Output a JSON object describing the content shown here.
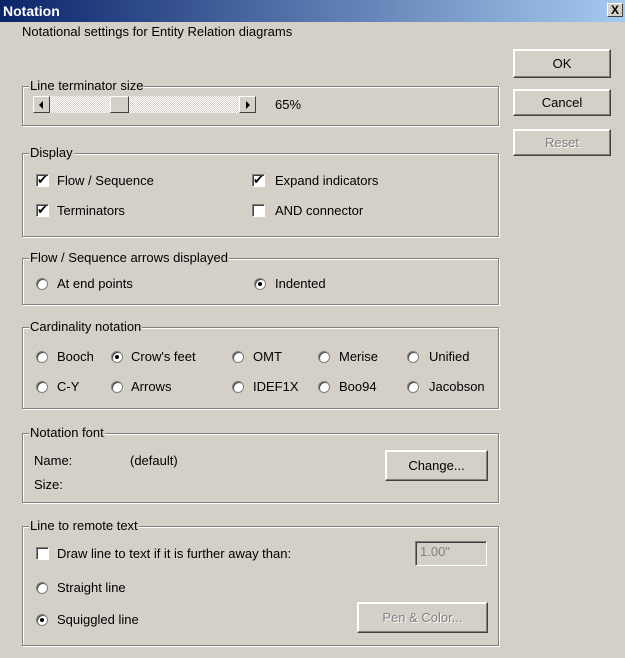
{
  "window": {
    "title": "Notation",
    "close_glyph": "X"
  },
  "intro": "Notational settings for Entity Relation diagrams",
  "buttons": {
    "ok": "OK",
    "cancel": "Cancel",
    "reset": "Reset"
  },
  "line_terminator": {
    "legend": "Line terminator size",
    "value_label": "65%",
    "value_fraction": 0.65
  },
  "display": {
    "legend": "Display",
    "flow_sequence": {
      "label": "Flow / Sequence",
      "checked": true
    },
    "expand_indicators": {
      "label": "Expand indicators",
      "checked": true
    },
    "terminators": {
      "label": "Terminators",
      "checked": true
    },
    "and_connector": {
      "label": "AND connector",
      "checked": false
    }
  },
  "arrows": {
    "legend": "Flow / Sequence arrows displayed",
    "at_end_points": "At end points",
    "indented": "Indented",
    "selected": "Indented"
  },
  "cardinality": {
    "legend": "Cardinality notation",
    "options": [
      "Booch",
      "Crow's feet",
      "OMT",
      "Merise",
      "Unified",
      "C-Y",
      "Arrows",
      "IDEF1X",
      "Boo94",
      "Jacobson"
    ],
    "selected": "Crow's feet"
  },
  "font": {
    "legend": "Notation font",
    "name_label": "Name:",
    "name_value": "(default)",
    "size_label": "Size:",
    "change_button": "Change..."
  },
  "remote_text": {
    "legend": "Line to remote text",
    "draw_line_label": "Draw line to text if it is further away than:",
    "draw_line_checked": false,
    "distance_value": "1.00\"",
    "straight_line": "Straight line",
    "squiggled_line": "Squiggled line",
    "selected": "Squiggled line",
    "pen_color_button": "Pen & Color..."
  }
}
